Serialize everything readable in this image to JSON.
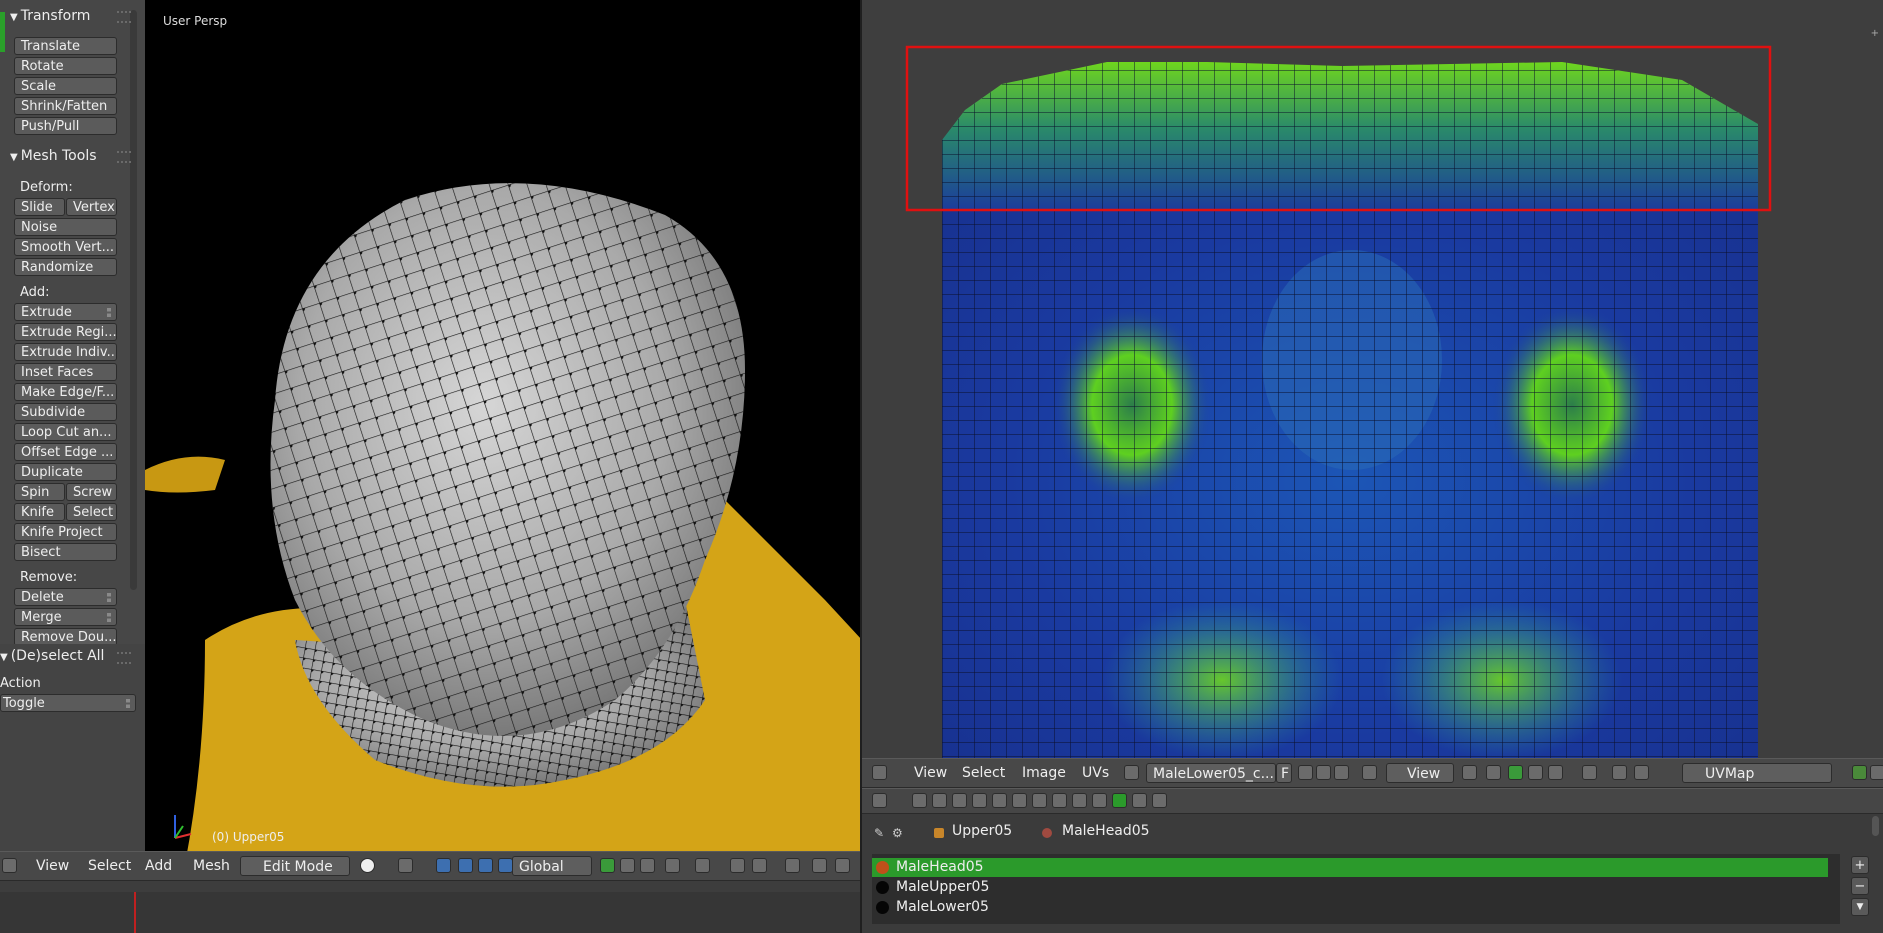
{
  "tool_shelf": {
    "transform_panel": {
      "title": "Transform",
      "buttons": [
        "Translate",
        "Rotate",
        "Scale",
        "Shrink/Fatten",
        "Push/Pull"
      ]
    },
    "mesh_tools_panel": {
      "title": "Mesh Tools",
      "deform_label": "Deform:",
      "slide": "Slide",
      "vertex": "Vertex",
      "noise": "Noise",
      "smooth_vertex": "Smooth Vert...",
      "randomize": "Randomize",
      "add_label": "Add:",
      "extrude": "Extrude",
      "extrude_region": "Extrude Regi...",
      "extrude_individual": "Extrude Indiv...",
      "inset_faces": "Inset Faces",
      "make_edge_face": "Make Edge/F...",
      "subdivide": "Subdivide",
      "loop_cut": "Loop Cut an...",
      "offset_edge": "Offset Edge ...",
      "duplicate": "Duplicate",
      "spin": "Spin",
      "screw": "Screw",
      "knife": "Knife",
      "select": "Select",
      "knife_project": "Knife Project",
      "bisect": "Bisect",
      "remove_label": "Remove:",
      "delete": "Delete",
      "merge": "Merge",
      "remove_doubles": "Remove Dou..."
    },
    "operator_panel": {
      "title": "(De)select All",
      "action_label": "Action",
      "action_value": "Toggle"
    }
  },
  "viewport3d": {
    "view_label": "User Persp",
    "object_label": "(0) Upper05",
    "header": {
      "menus": [
        "View",
        "Select",
        "Add",
        "Mesh"
      ],
      "mode": "Edit Mode",
      "orientation": "Global"
    }
  },
  "uv_editor": {
    "header": {
      "menus": [
        "View",
        "Select",
        "Image",
        "UVs"
      ],
      "image_name": "MaleLower05_c...",
      "fake_user": "F",
      "view_dropdown": "View",
      "uv_map": "UVMap"
    },
    "highlight_color": "#e01010"
  },
  "properties": {
    "breadcrumb": [
      "Upper05",
      "MaleHead05"
    ],
    "materials": [
      "MaleHead05",
      "MaleUpper05",
      "MaleLower05"
    ],
    "selected_material": "MaleHead05",
    "add_button": "+",
    "remove_button": "−"
  },
  "colors": {
    "selection_green": "#2b9a2b",
    "mesh_gold": "#d4a417",
    "uv_blue": "#1a3a9a",
    "uv_green": "#5ed020"
  }
}
